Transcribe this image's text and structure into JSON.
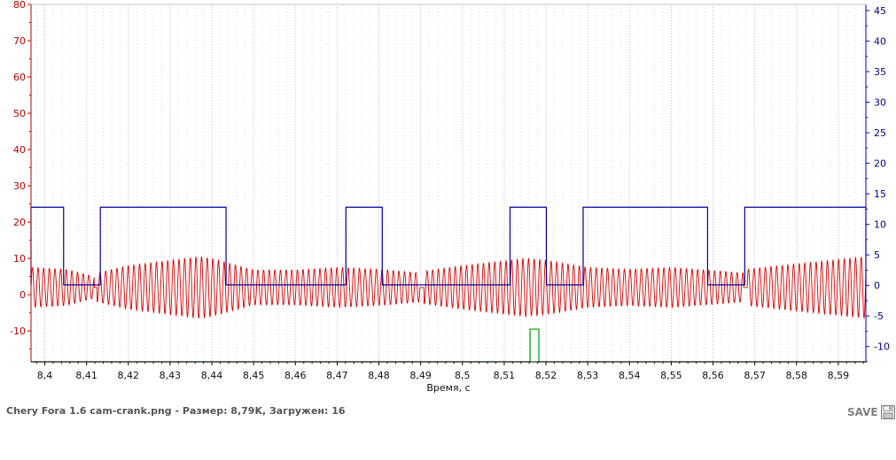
{
  "chart_data": {
    "type": "line",
    "xlabel": "Время, с",
    "x_ticks": [
      "8,4",
      "8,41",
      "8,42",
      "8,43",
      "8,44",
      "8,45",
      "8,46",
      "8,47",
      "8,48",
      "8,49",
      "8,5",
      "8,51",
      "8,52",
      "8,53",
      "8,54",
      "8,55",
      "8,56",
      "8,57",
      "8,58",
      "8,59"
    ],
    "x_tick_values": [
      8.4,
      8.41,
      8.42,
      8.43,
      8.44,
      8.45,
      8.46,
      8.47,
      8.48,
      8.49,
      8.5,
      8.51,
      8.52,
      8.53,
      8.54,
      8.55,
      8.56,
      8.57,
      8.58,
      8.59
    ],
    "xlim": [
      8.3967,
      8.5966
    ],
    "y_left_ticks": [
      "80",
      "70",
      "60",
      "50",
      "40",
      "30",
      "20",
      "10",
      "0",
      "-10"
    ],
    "y_left_tick_values": [
      80,
      70,
      60,
      50,
      40,
      30,
      20,
      10,
      0,
      -10
    ],
    "y_left_lim": [
      -18.5,
      80
    ],
    "y_right_ticks": [
      "45",
      "40",
      "35",
      "30",
      "25",
      "20",
      "15",
      "10",
      "5",
      "0",
      "-5",
      "-10"
    ],
    "y_right_tick_values": [
      45,
      40,
      35,
      30,
      25,
      20,
      15,
      10,
      5,
      0,
      -5,
      -10
    ],
    "y_right_lim": [
      -12.5,
      46
    ],
    "grid": "vertical-dotted",
    "series": [
      {
        "axis": "left",
        "color": "#dd0000",
        "kind": "oscillation",
        "period": 0.00135,
        "center": 2,
        "gaps": [
          [
            8.4118,
            8.4125
          ],
          [
            8.4898,
            8.4908
          ],
          [
            8.5673,
            8.5682
          ]
        ],
        "amplitude": [
          [
            8.3967,
            5.5
          ],
          [
            8.405,
            5.0
          ],
          [
            8.4118,
            3.0
          ],
          [
            8.4125,
            4.0
          ],
          [
            8.42,
            6.0
          ],
          [
            8.437,
            8.5
          ],
          [
            8.44,
            8.0
          ],
          [
            8.45,
            4.8
          ],
          [
            8.46,
            4.8
          ],
          [
            8.47,
            5.5
          ],
          [
            8.48,
            5.0
          ],
          [
            8.4898,
            4.0
          ],
          [
            8.4908,
            4.5
          ],
          [
            8.5,
            6.0
          ],
          [
            8.515,
            8.0
          ],
          [
            8.52,
            7.5
          ],
          [
            8.53,
            5.5
          ],
          [
            8.54,
            5.0
          ],
          [
            8.55,
            5.5
          ],
          [
            8.5673,
            4.0
          ],
          [
            8.5682,
            5.0
          ],
          [
            8.58,
            6.5
          ],
          [
            8.5966,
            8.5
          ]
        ]
      },
      {
        "axis": "right",
        "color": "#000099",
        "kind": "step",
        "high": 12.8,
        "low": 0.1,
        "high_intervals": [
          [
            8.3967,
            8.4045
          ],
          [
            8.4133,
            8.4434
          ],
          [
            8.4721,
            8.4808
          ],
          [
            8.5114,
            8.5201
          ],
          [
            8.5289,
            8.5587
          ],
          [
            8.5676,
            8.5966
          ]
        ]
      },
      {
        "axis": "left",
        "color": "#009900",
        "kind": "step",
        "high": -9.5,
        "low": -18.5,
        "high_intervals": [
          [
            8.5162,
            8.5183
          ]
        ]
      }
    ]
  },
  "footer": {
    "caption": "Chery Fora 1.6 cam-crank.png - Размер: 8,79K, Загружен: 16",
    "save_label": "SAVE"
  }
}
